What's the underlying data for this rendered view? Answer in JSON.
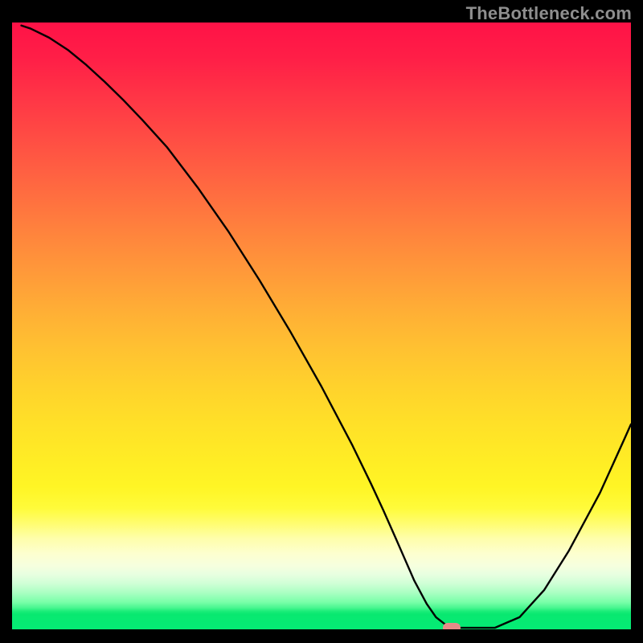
{
  "watermark": "TheBottleneck.com",
  "colors": {
    "stroke": "#000000",
    "background_top": "#ff1247",
    "background_bottom": "#06eb75",
    "marker": "#e68b88"
  },
  "chart_data": {
    "type": "line",
    "title": "",
    "xlabel": "",
    "ylabel": "",
    "xlim": [
      0,
      100
    ],
    "ylim": [
      0,
      100
    ],
    "grid": false,
    "legend": false,
    "x": [
      0,
      1.5,
      3,
      6,
      9,
      12,
      15,
      18,
      21,
      25,
      30,
      35,
      40,
      45,
      50,
      55,
      58,
      60,
      62,
      63.5,
      65,
      67,
      68.5,
      70,
      72,
      75,
      78,
      82,
      86,
      90,
      95,
      99,
      100
    ],
    "values": [
      null,
      99.5,
      99.0,
      97.5,
      95.5,
      93.0,
      90.2,
      87.2,
      84.0,
      79.5,
      72.8,
      65.5,
      57.5,
      49.0,
      40.0,
      30.3,
      24.0,
      19.6,
      15.0,
      11.5,
      8.0,
      4.2,
      2.0,
      0.8,
      0.25,
      0.25,
      0.25,
      2.0,
      6.5,
      13.0,
      22.5,
      31.5,
      33.8
    ],
    "annotations": [
      {
        "type": "marker",
        "x": 71,
        "y": 0.25,
        "shape": "rounded-rect"
      }
    ]
  }
}
